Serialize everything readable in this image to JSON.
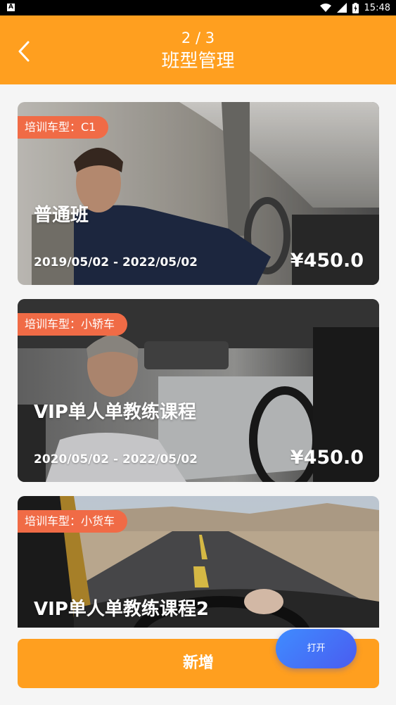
{
  "status_bar": {
    "time": "15:48",
    "notification_letter": "A"
  },
  "header": {
    "page_counter": "2 / 3",
    "title": "班型管理"
  },
  "cards": [
    {
      "tag": "培训车型：C1",
      "name": "普通班",
      "date_range": "2019/05/02 - 2022/05/02",
      "price": "¥450.0"
    },
    {
      "tag": "培训车型：小轿车",
      "name": "VIP单人单教练课程",
      "date_range": "2020/05/02 - 2022/05/02",
      "price": "¥450.0"
    },
    {
      "tag": "培训车型：小货车",
      "name": "VIP单人单教练课程2",
      "date_range": "",
      "price": ""
    }
  ],
  "actions": {
    "add_label": "新增",
    "open_label": "打开"
  },
  "colors": {
    "header_bg": "#ff9f1f",
    "tag_bg": "#f06b46",
    "add_button_bg": "#ff9f1f",
    "open_button_gradient": [
      "#3f8cff",
      "#4a5cf0"
    ]
  }
}
